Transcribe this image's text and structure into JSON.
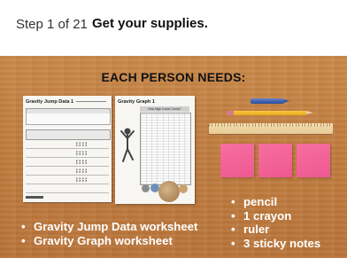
{
  "header": {
    "step_label": "Step 1 of 21",
    "title": "Get your supplies."
  },
  "slide": {
    "heading": "EACH PERSON NEEDS:",
    "worksheet1": {
      "title": "Gravity Jump Data 1"
    },
    "worksheet2": {
      "title": "Gravity Graph 1",
      "chart_title": "How High Could I Jump?"
    },
    "supplies_list": [
      {
        "label": "pencil"
      },
      {
        "label": "1 crayon"
      },
      {
        "label": "ruler"
      },
      {
        "label": "3 sticky notes"
      }
    ],
    "worksheets_list": [
      {
        "label": "Gravity Jump Data worksheet"
      },
      {
        "label": "Gravity Graph worksheet"
      }
    ]
  },
  "colors": {
    "wood": "#c07d3f",
    "sticky_note": "#f26596",
    "crayon": "#3f5fae",
    "pencil": "#e9a91b",
    "list_text": "#ffffff"
  }
}
